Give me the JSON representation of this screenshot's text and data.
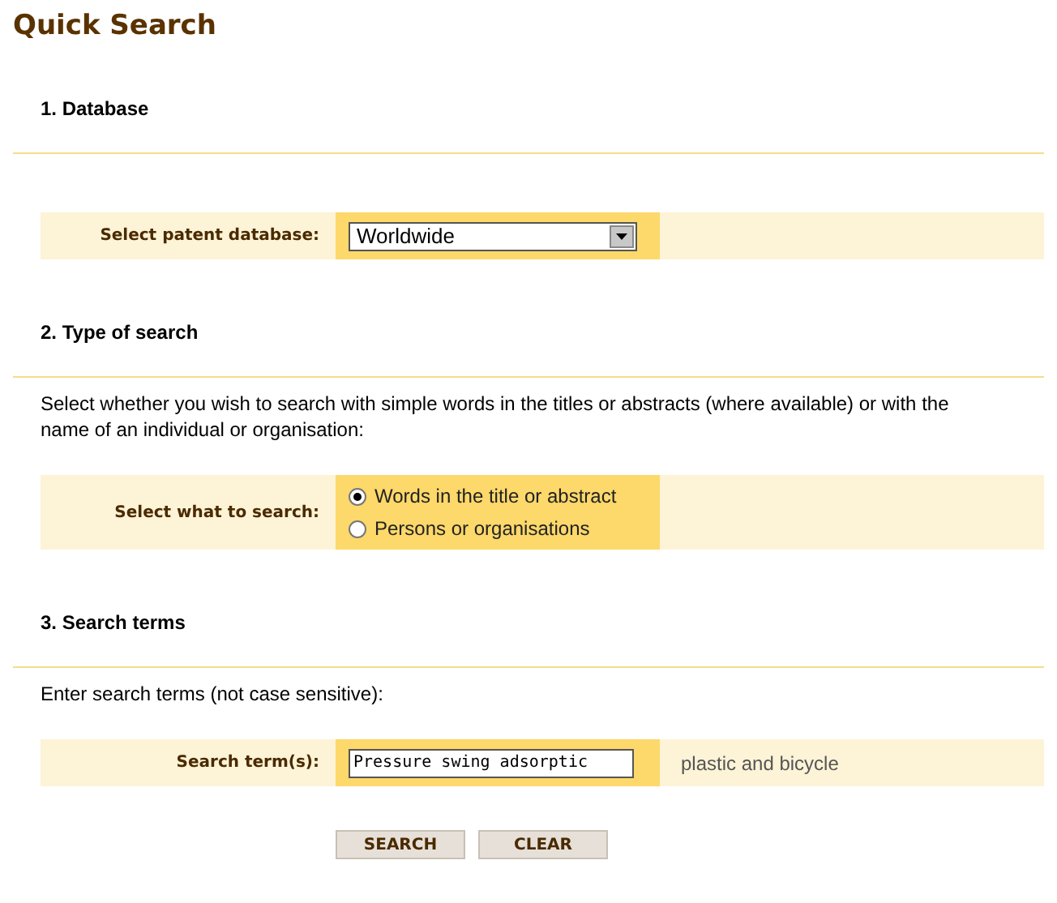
{
  "title": "Quick Search",
  "sections": [
    {
      "heading": "1. Database",
      "kind": "select",
      "label": "Select patent database:",
      "value": "Worldwide"
    },
    {
      "heading": "2. Type of search",
      "kind": "radio",
      "intro": "Select whether you wish to search with simple words in the titles or abstracts (where available) or with the name of an individual or organisation:",
      "label": "Select what to search:",
      "options": [
        {
          "label": "Words in the title or abstract",
          "selected": true
        },
        {
          "label": "Persons or organisations",
          "selected": false
        }
      ]
    },
    {
      "heading": "3. Search terms",
      "kind": "text",
      "intro": "Enter search terms (not case sensitive):",
      "label": "Search term(s):",
      "value": "Pressure swing adsorptic",
      "hint": "plastic and bicycle"
    }
  ],
  "buttons": [
    "SEARCH",
    "CLEAR"
  ]
}
